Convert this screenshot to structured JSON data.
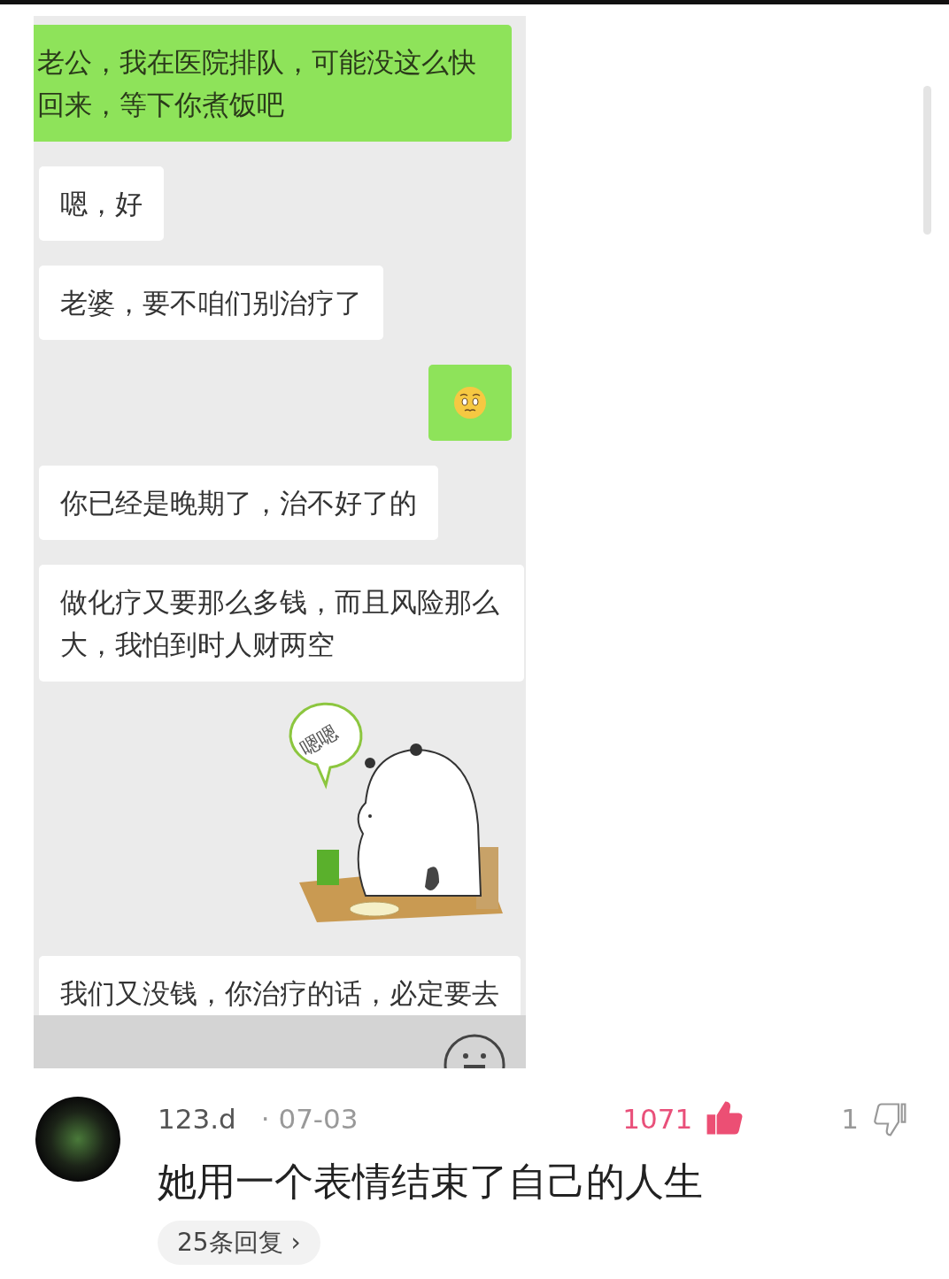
{
  "chat_image": {
    "messages": [
      {
        "kind": "text",
        "outgoing": true,
        "text": "老公，我在医院排队，可能没这么快回来，等下你煮饭吧"
      },
      {
        "kind": "text",
        "outgoing": false,
        "text": "嗯，好"
      },
      {
        "kind": "text",
        "outgoing": false,
        "text": "老婆，要不咱们别治疗了"
      },
      {
        "kind": "emoji",
        "outgoing": true
      },
      {
        "kind": "text",
        "outgoing": false,
        "text": "你已经是晚期了，治不好了的"
      },
      {
        "kind": "text",
        "outgoing": false,
        "text": "做化疗又要那么多钱，而且风险那么大，我怕到时人财两空"
      },
      {
        "kind": "sticker",
        "outgoing": true,
        "text": "嗯嗯"
      },
      {
        "kind": "text",
        "outgoing": false,
        "text": "我们又没钱，你治疗的话，必定要去"
      }
    ]
  },
  "comment": {
    "username": "123.d",
    "date": "· 07-03",
    "text": "她用一个表情结束了自己的人生",
    "likes": "1071",
    "liked": true,
    "dislikes": "1",
    "disliked": false,
    "replies": "25条回复 ›"
  }
}
